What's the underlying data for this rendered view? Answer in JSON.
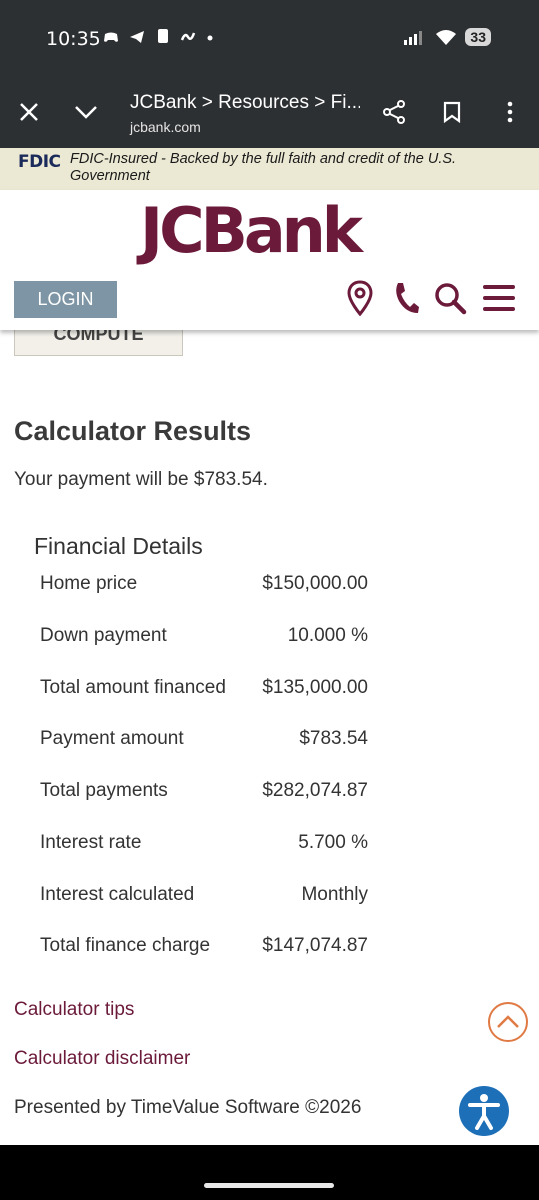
{
  "status_bar": {
    "time": "10:35",
    "battery": "33",
    "notification_icons": [
      "game-controller-icon",
      "telegram-icon",
      "phone-icon",
      "wave-icon",
      "dot-icon"
    ]
  },
  "browser": {
    "title": "JCBank > Resources > Fi...",
    "url": "jcbank.com"
  },
  "fdic": {
    "logo": "FDIC",
    "text": "FDIC-Insured - Backed by the full faith and credit of the U.S. Government"
  },
  "header": {
    "brand": "JCBank",
    "login_label": "LOGIN",
    "brand_color": "#6b1a3a"
  },
  "calculator": {
    "compute_label": "COMPUTE",
    "results_title": "Calculator Results",
    "summary": "Your payment will be $783.54.",
    "financial_details_title": "Financial Details",
    "rows": [
      {
        "label": "Home price",
        "value": "$150,000.00"
      },
      {
        "label": "Down payment",
        "value": "10.000 %"
      },
      {
        "label": "Total amount financed",
        "value": "$135,000.00"
      },
      {
        "label": "Payment amount",
        "value": "$783.54"
      },
      {
        "label": "Total payments",
        "value": "$282,074.87"
      },
      {
        "label": "Interest rate",
        "value": "5.700 %"
      },
      {
        "label": "Interest calculated",
        "value": "Monthly"
      },
      {
        "label": "Total finance charge",
        "value": "$147,074.87"
      }
    ],
    "link_tips": "Calculator tips",
    "link_disclaimer": "Calculator disclaimer",
    "presented_by": "Presented by TimeValue Software ©2026"
  }
}
